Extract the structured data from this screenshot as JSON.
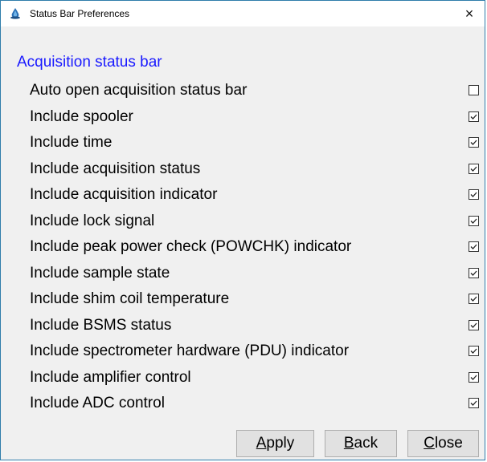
{
  "window": {
    "title": "Status Bar Preferences",
    "close_glyph": "×",
    "app_icon": "topspin-icon"
  },
  "section": {
    "header": "Acquisition status bar"
  },
  "options": [
    {
      "label": "Auto open acquisition status bar",
      "checked": false
    },
    {
      "label": "Include spooler",
      "checked": true
    },
    {
      "label": "Include time",
      "checked": true
    },
    {
      "label": "Include acquisition status",
      "checked": true
    },
    {
      "label": "Include acquisition indicator",
      "checked": true
    },
    {
      "label": "Include lock signal",
      "checked": true
    },
    {
      "label": "Include peak power check (POWCHK) indicator",
      "checked": true
    },
    {
      "label": "Include sample state",
      "checked": true
    },
    {
      "label": "Include shim coil temperature",
      "checked": true
    },
    {
      "label": "Include BSMS status",
      "checked": true
    },
    {
      "label": "Include spectrometer hardware (PDU) indicator",
      "checked": true
    },
    {
      "label": "Include amplifier control",
      "checked": true
    },
    {
      "label": "Include ADC control",
      "checked": true
    }
  ],
  "buttons": {
    "apply": {
      "first": "A",
      "rest": "pply"
    },
    "back": {
      "first": "B",
      "rest": "ack"
    },
    "close": {
      "first": "C",
      "rest": "lose"
    }
  },
  "colors": {
    "section_header": "#1a1aff",
    "window_border": "#2f7dab",
    "dialog_background": "#f0f0f0"
  }
}
